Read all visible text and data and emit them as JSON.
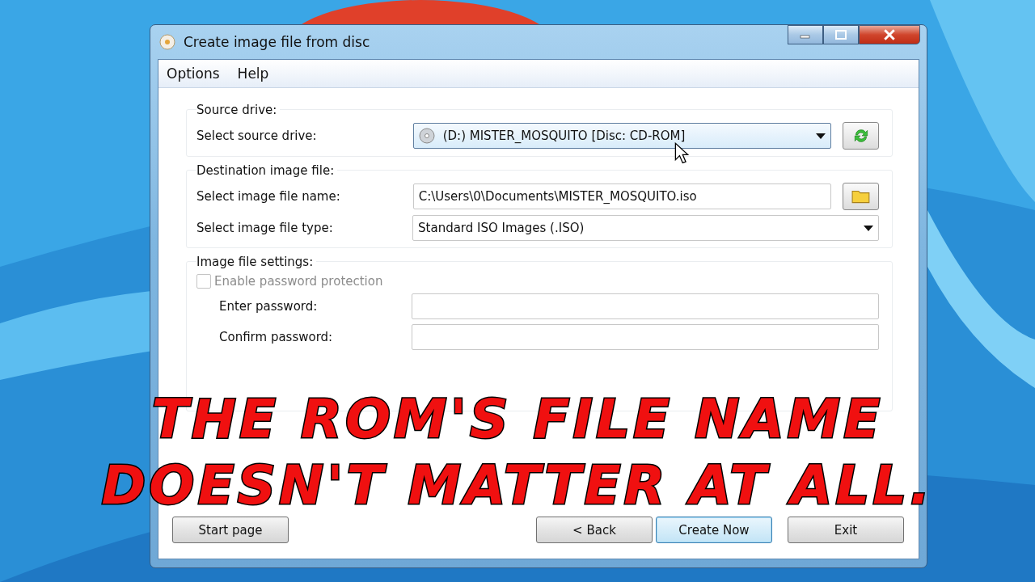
{
  "window": {
    "title": "Create image file from disc"
  },
  "menu": [
    "Options",
    "Help"
  ],
  "source_drive": {
    "title": "Source drive:",
    "label": "Select source drive:",
    "value": "(D:) MISTER_MOSQUITO [Disc: CD-ROM]"
  },
  "destination": {
    "title": "Destination image file:",
    "name_label": "Select image file name:",
    "name_value": "C:\\Users\\0\\Documents\\MISTER_MOSQUITO.iso",
    "type_label": "Select image file type:",
    "type_value": "Standard ISO Images (.ISO)"
  },
  "settings": {
    "title": "Image file settings:",
    "password_protection": {
      "label": "Enable password protection",
      "checked": false,
      "disabled": true
    },
    "fields": [
      {
        "label": "Enter password:"
      },
      {
        "label": "Confirm password:"
      }
    ]
  },
  "buttons": [
    {
      "label": "Start page",
      "default": false
    },
    {
      "label": "< Back",
      "default": false
    },
    {
      "label": "Create Now",
      "default": true
    },
    {
      "label": "Exit",
      "default": false
    }
  ],
  "caption": [
    "THE ROM'S FILE NAME",
    "DOESN'T MATTER AT ALL."
  ]
}
